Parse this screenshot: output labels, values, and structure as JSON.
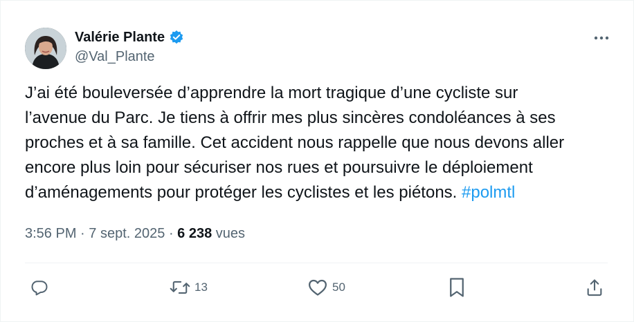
{
  "author": {
    "name": "Valérie Plante",
    "handle": "@Val_Plante"
  },
  "tweet": {
    "lines": [
      "J’ai été bouleversée d’apprendre la mort tragique d’une cycliste sur",
      "l’avenue du Parc. Je tiens à offrir mes plus sincères condoléances à ses",
      "proches et à sa famille. Cet accident nous rappelle que nous devons aller",
      "encore plus loin pour sécuriser nos rues et poursuivre le déploiement",
      "d’aménagements pour protéger les cyclistes et les piétons."
    ],
    "hashtag": "#polmtl"
  },
  "meta": {
    "time": "3:56 PM",
    "sep1": "·",
    "date": "7 sept. 2025",
    "sep2": "·",
    "views_count": "6 238",
    "views_label": "vues"
  },
  "actions": {
    "reply_icon": "reply-icon",
    "retweet_icon": "retweet-icon",
    "retweet_count": "13",
    "like_icon": "heart-icon",
    "like_count": "50",
    "bookmark_icon": "bookmark-icon",
    "share_icon": "share-icon"
  },
  "colors": {
    "accent": "#1d9bf0",
    "text": "#0f1419",
    "muted": "#536471"
  }
}
